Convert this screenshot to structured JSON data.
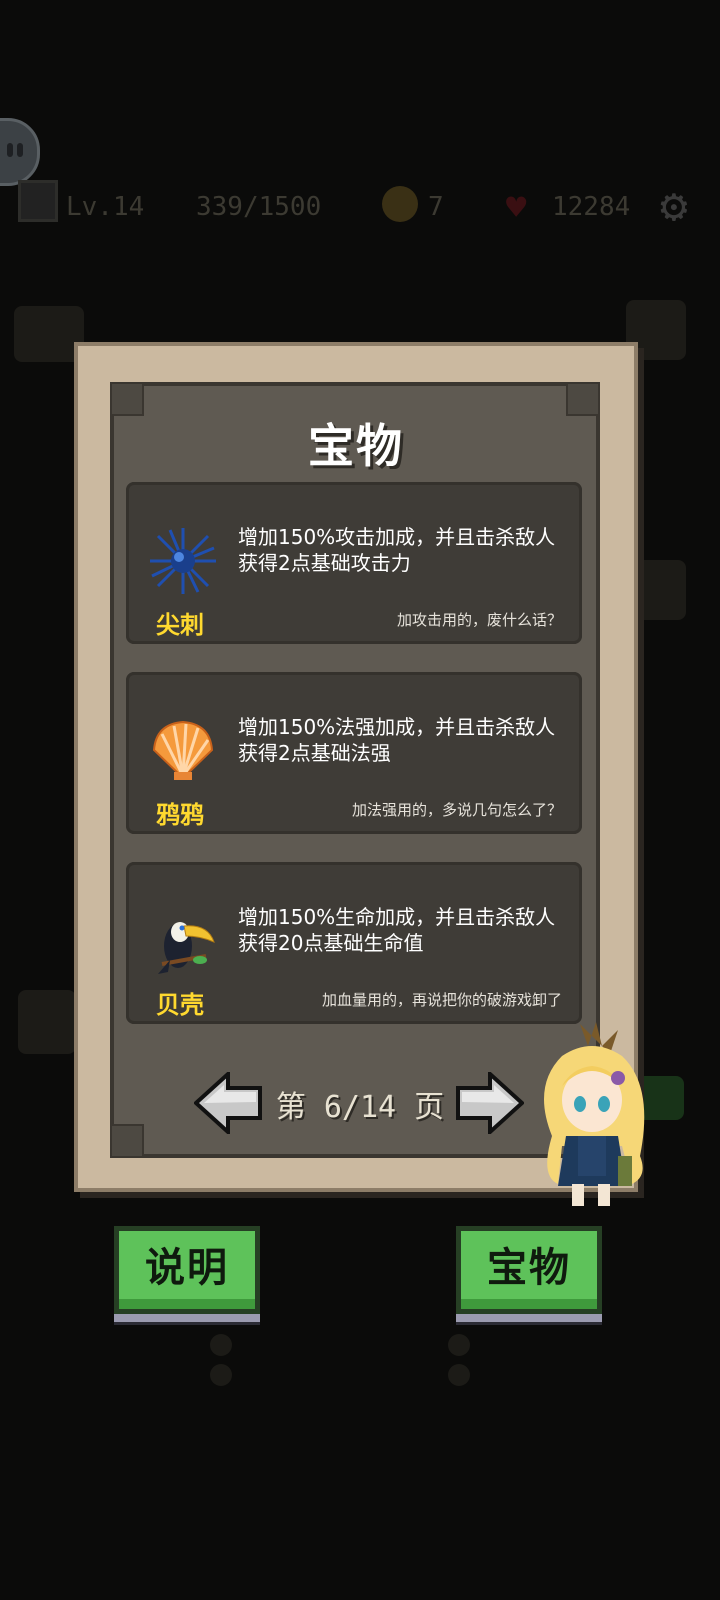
{
  "hud": {
    "level": "Lv.14",
    "xp": "339/1500",
    "coins": "7",
    "hp": "12284"
  },
  "dialog": {
    "title": "宝物",
    "items": [
      {
        "name": "尖刺",
        "icon": "blue-spike-icon",
        "desc_line1": "增加150%攻击加成，并且击杀敌人",
        "desc_line2": "获得2点基础攻击力",
        "quip": "加攻击用的，废什么话？"
      },
      {
        "name": "鸦鸦",
        "icon": "seashell-icon",
        "desc_line1": "增加150%法强加成，并且击杀敌人",
        "desc_line2": "获得2点基础法强",
        "quip": "加法强用的，多说几句怎么了？"
      },
      {
        "name": "贝壳",
        "icon": "toucan-icon",
        "desc_line1": "增加150%生命加成，并且击杀敌人",
        "desc_line2": "获得20点基础生命值",
        "quip": "加血量用的，再说把你的破游戏卸了"
      }
    ],
    "pager": {
      "text": "第 6/14 页"
    }
  },
  "buttons": {
    "explain": "说明",
    "treasure": "宝物"
  },
  "colors": {
    "item_name": "#ffd92f",
    "button_green": "#5ec25a",
    "frame": "#cbb9a0",
    "panel": "#5f5a52"
  }
}
